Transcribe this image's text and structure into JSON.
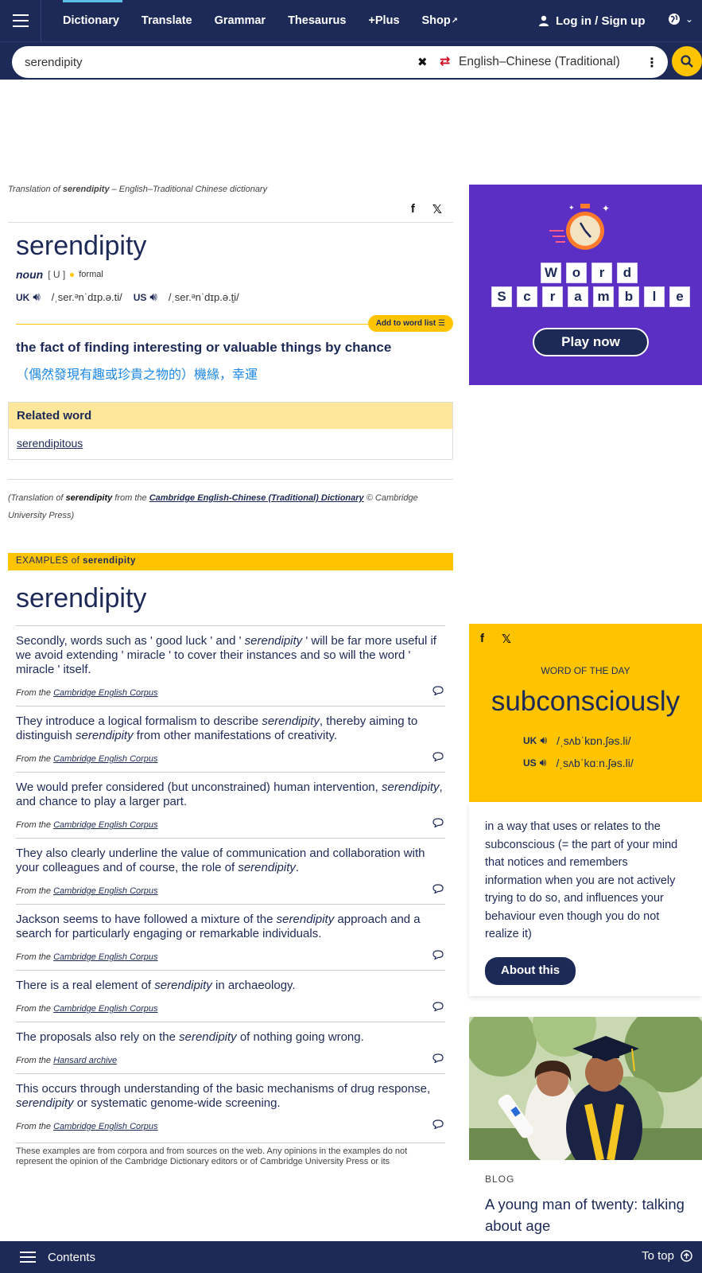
{
  "nav": {
    "items": [
      "Dictionary",
      "Translate",
      "Grammar",
      "Thesaurus",
      "+Plus",
      "Shop"
    ],
    "login": "Log in / Sign up"
  },
  "search": {
    "value": "serendipity",
    "dictionary": "English–Chinese (Traditional)"
  },
  "entry": {
    "caption_prefix": "Translation of ",
    "caption_word": "serendipity",
    "caption_suffix": " – English–Traditional Chinese dictionary",
    "headword": "serendipity",
    "pos": "noun",
    "grammar": "[ U ]",
    "register": "formal",
    "uk_label": "UK",
    "uk_ipa": "/ˌser.ᵊnˈdɪp.ə.ti/",
    "us_label": "US",
    "us_ipa": "/ˌser.ᵊnˈdɪp.ə.t̬i/",
    "add_to_list": "Add to word list",
    "definition": "the fact of finding interesting or valuable things by chance",
    "translation": "（偶然發現有趣或珍貴之物的）機緣，幸運",
    "related_heading": "Related word",
    "related_word": "serendipitous",
    "source_prefix": "(Translation of ",
    "source_word": "serendipity",
    "source_mid": " from the ",
    "source_link": "Cambridge English-Chinese (Traditional) Dictionary",
    "source_suffix": " © Cambridge University Press)"
  },
  "examples": {
    "bar_prefix": "EXAMPLES",
    "bar_of": " of ",
    "bar_word": "serendipity",
    "heading": "serendipity",
    "from_label": "From the ",
    "items": [
      {
        "before": "Secondly, words such as ' good luck ' and ' ",
        "word": "serendipity",
        "after": " ' will be far more useful if we avoid extending ' miracle ' to cover their instances and so will the word ' miracle ' itself.",
        "source": "Cambridge English Corpus"
      },
      {
        "before": "They introduce a logical formalism to describe ",
        "word": "serendipity",
        "after": ", thereby aiming to distinguish ",
        "word2": "serendipity",
        "after2": " from other manifestations of creativity.",
        "source": "Cambridge English Corpus"
      },
      {
        "before": "We would prefer considered (but unconstrained) human intervention, ",
        "word": "serendipity",
        "after": ", and chance to play a larger part.",
        "source": "Cambridge English Corpus"
      },
      {
        "before": "They also clearly underline the value of communication and collaboration with your colleagues and of course, the role of ",
        "word": "serendipity",
        "after": ".",
        "source": "Cambridge English Corpus"
      },
      {
        "before": "Jackson seems to have followed a mixture of the ",
        "word": "serendipity",
        "after": " approach and a search for particularly engaging or remarkable individuals.",
        "source": "Cambridge English Corpus"
      },
      {
        "before": "There is a real element of ",
        "word": "serendipity",
        "after": " in archaeology.",
        "source": "Cambridge English Corpus"
      },
      {
        "before": "The proposals also rely on the ",
        "word": "serendipity",
        "after": " of nothing going wrong.",
        "source": "Hansard archive"
      },
      {
        "before": "This occurs through understanding of the basic mechanisms of drug response, ",
        "word": "serendipity",
        "after": " or systematic genome-wide screening.",
        "source": "Cambridge English Corpus"
      }
    ],
    "disclaimer": "These examples are from corpora and from sources on the web. Any opinions in the examples do not represent the opinion of the Cambridge Dictionary editors or of Cambridge University Press or its"
  },
  "ad": {
    "row1": [
      "W",
      "o",
      "r",
      "d"
    ],
    "row2": [
      "S",
      "c",
      "r",
      "a",
      "m",
      "b",
      "l",
      "e"
    ],
    "button": "Play now"
  },
  "wotd": {
    "label": "WORD OF THE DAY",
    "word": "subconsciously",
    "uk_label": "UK",
    "uk_ipa": "/ˌsʌbˈkɒn.ʃəs.li/",
    "us_label": "US",
    "us_ipa": "/ˌsʌbˈkɑːn.ʃəs.li/",
    "definition": "in a way that uses or relates to the subconscious (= the part of your mind that notices and remembers information when you are not actively trying to do so, and influences your behaviour even though you do not realize it)",
    "button": "About this"
  },
  "blog": {
    "label": "BLOG",
    "title": "A young man of twenty: talking about age"
  },
  "bottom": {
    "contents": "Contents",
    "to_top": "To top"
  },
  "colors": {
    "navy": "#1d2a57",
    "yellow": "#fec400",
    "light_yellow": "#fee79b",
    "translation_blue": "#1e88e5",
    "ad_purple": "#5b2fc3"
  }
}
